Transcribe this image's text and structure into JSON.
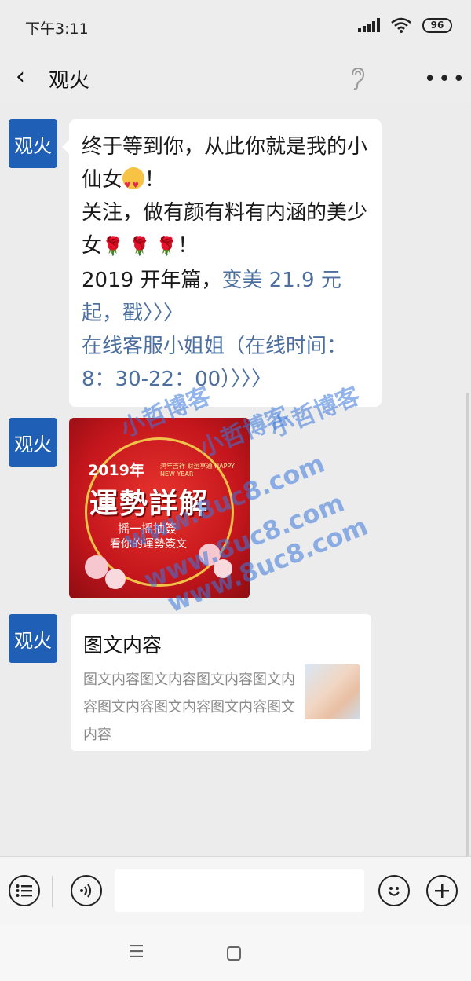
{
  "status_bar": {
    "time": "下午3:11",
    "battery": "96"
  },
  "nav": {
    "back_glyph": "‹",
    "title": "观火",
    "more_glyph": "•••"
  },
  "messages": {
    "avatar_label": "观火",
    "text": {
      "line1": "终于等到你，从此你就是我的小仙女",
      "line1_end": "！",
      "line2": "关注，做有颜有料有内涵的美少女",
      "line2_end": "！",
      "line3_prefix": "2019 开年篇，",
      "link1": "变美 21.9 元起，戳〉〉〉",
      "link2": "在线客服小姐姐（在线时间：8：30-22：00）〉〉〉"
    },
    "image": {
      "year": "2019年",
      "subtitle": "鸿年吉祥 财运亨通 HAPPY NEW YEAR",
      "title": "運勢詳解",
      "line1": "摇一摇抽簽",
      "line2": "看你的運勢簽文"
    },
    "card": {
      "title": "图文内容",
      "description": "图文内容图文内容图文内容图文内容图文内容图文内容图文内容图文内容"
    }
  },
  "watermarks": [
    "小哲博客",
    "小哲博客",
    "小哲博客",
    "www.8uc8.com",
    "www.8uc8.com",
    "www.8uc8.com"
  ],
  "icons": {
    "voice": "voice-icon",
    "emoji": "emoji-icon",
    "add": "plus-icon",
    "menu": "list-icon"
  }
}
